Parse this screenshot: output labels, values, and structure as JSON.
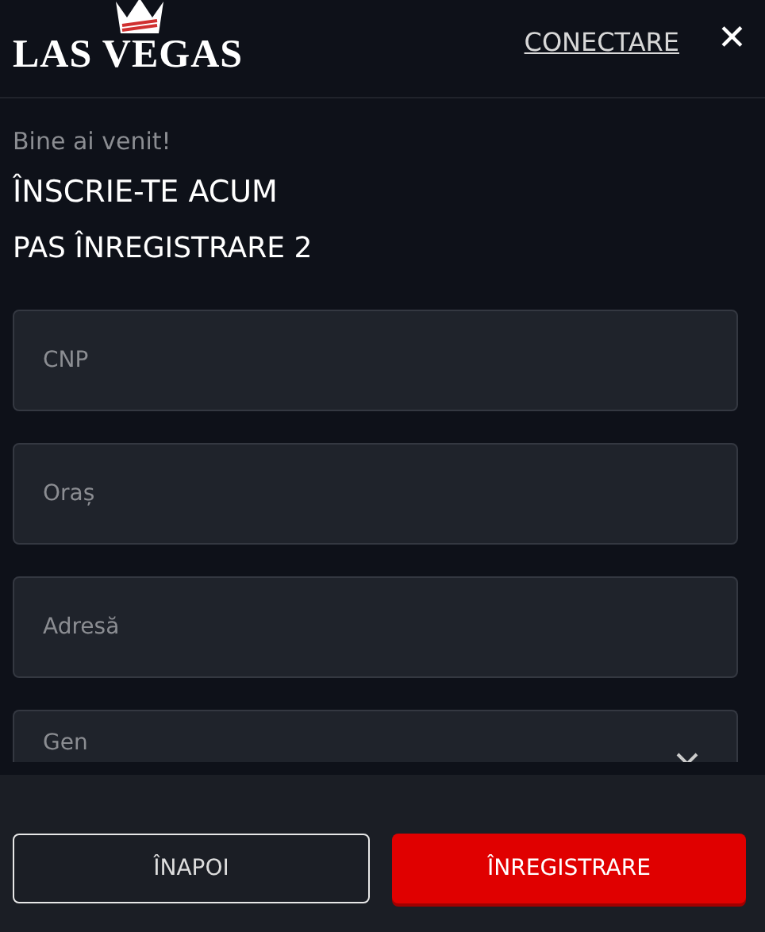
{
  "header": {
    "logo": "LAS VEGAS",
    "login_link": "CONECTARE",
    "close": "✕"
  },
  "greeting": "Bine ai venit!",
  "title": "ÎNSCRIE-TE ACUM",
  "step": "PAS ÎNREGISTRARE 2",
  "fields": [
    {
      "kind": "text",
      "placeholder": "CNP"
    },
    {
      "kind": "text",
      "placeholder": "Oraș"
    },
    {
      "kind": "text",
      "placeholder": "Adresă"
    },
    {
      "kind": "select",
      "placeholder": "Gen"
    }
  ],
  "buttons": [
    {
      "kind": "secondary",
      "label": "ÎNAPOI"
    },
    {
      "kind": "primary",
      "label": "ÎNREGISTRARE"
    }
  ]
}
